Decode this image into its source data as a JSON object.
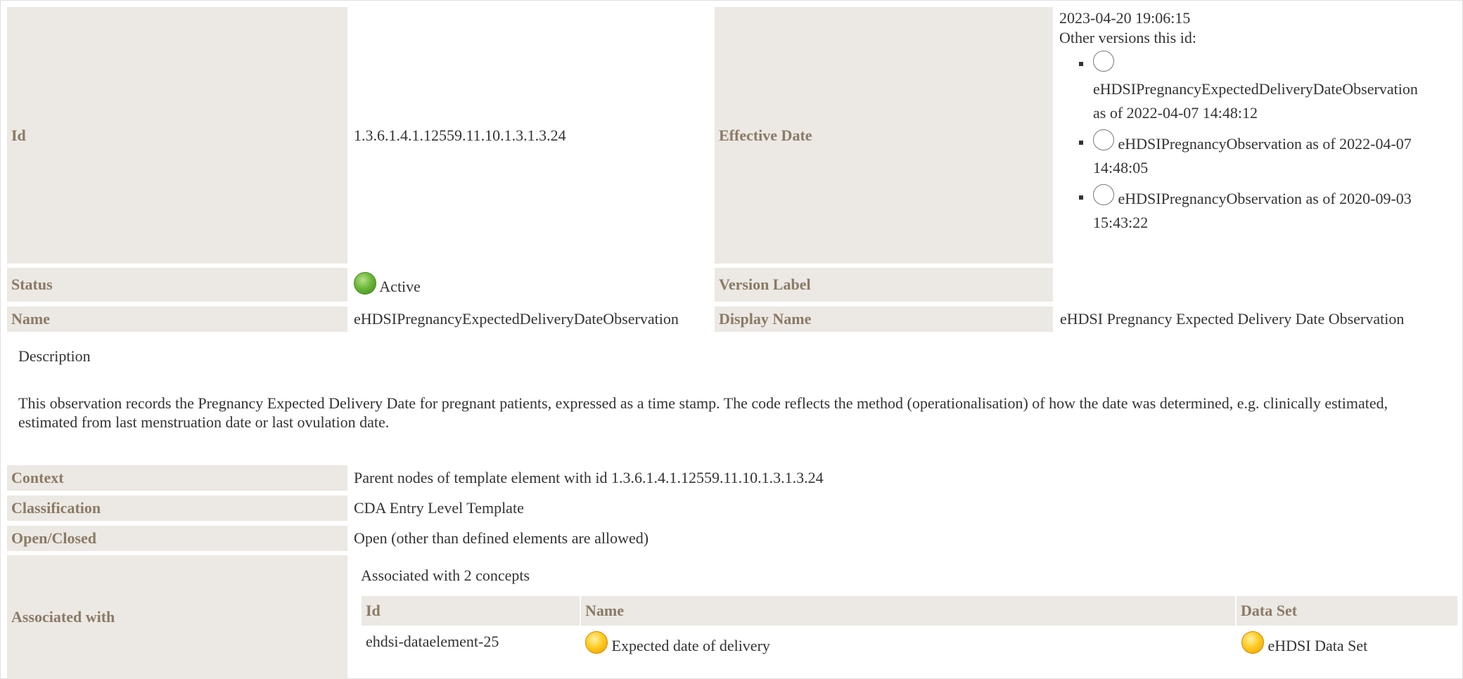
{
  "template": {
    "id_label": "Id",
    "id_value": "1.3.6.1.4.1.12559.11.10.1.3.1.3.24",
    "effective_date_label": "Effective Date",
    "effective_date": "2023-04-20 19:06:15",
    "other_versions_label": "Other versions this id:",
    "versions": [
      {
        "name": "eHDSIPregnancyExpectedDeliveryDateObservation",
        "as_of": "as of 2022-04-07 14:48:12"
      },
      {
        "name": "eHDSIPregnancyObservation as of 2022-04-07",
        "as_of": "14:48:05"
      },
      {
        "name": "eHDSIPregnancyObservation as of 2020-09-03",
        "as_of": "15:43:22"
      }
    ],
    "status_label": "Status",
    "status_value": "Active",
    "status_color": "#5fae32",
    "version_label_label": "Version Label",
    "name_label": "Name",
    "name_value": "eHDSIPregnancyExpectedDeliveryDateObservation",
    "display_name_label": "Display Name",
    "display_name_value": "eHDSI Pregnancy Expected Delivery Date Observation"
  },
  "description": {
    "title": "Description",
    "text": "This observation records the Pregnancy Expected Delivery Date for pregnant patients, expressed as a time stamp. The code reflects the method (operationalisation) of how the date was determined, e.g. clinically estimated, estimated from last menstruation date or last ovulation date."
  },
  "details": {
    "context_label": "Context",
    "context_value": "Parent nodes of template element with id 1.3.6.1.4.1.12559.11.10.1.3.1.3.24",
    "classification_label": "Classification",
    "classification_value": "CDA Entry Level Template",
    "open_closed_label": "Open/Closed",
    "open_closed_value": "Open (other than defined elements are allowed)",
    "associated_label": "Associated with",
    "associated_summary": "Associated with 2 concepts",
    "assoc_headers": {
      "id": "Id",
      "name": "Name",
      "dataset": "Data Set"
    },
    "assoc_rows": [
      {
        "id": "ehdsi-dataelement-25",
        "name": "Expected date of delivery",
        "dataset": "eHDSI Data Set"
      }
    ]
  },
  "colors": {
    "label_bg": "#ece8e3",
    "label_text": "#8a7a66",
    "concept_status": "#ffc71a"
  }
}
